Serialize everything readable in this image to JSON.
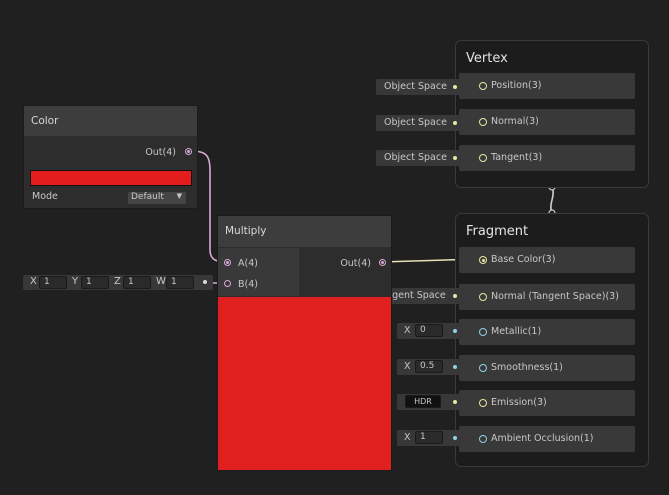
{
  "vertex": {
    "title": "Vertex",
    "slots": [
      {
        "label": "Position(3)",
        "input": "Object Space"
      },
      {
        "label": "Normal(3)",
        "input": "Object Space"
      },
      {
        "label": "Tangent(3)",
        "input": "Object Space"
      }
    ]
  },
  "fragment": {
    "title": "Fragment",
    "slots": [
      {
        "label": "Base Color(3)"
      },
      {
        "label": "Normal (Tangent Space)(3)",
        "input": "Tangent Space"
      },
      {
        "label": "Metallic(1)",
        "input_x_label": "X",
        "input_value": "0"
      },
      {
        "label": "Smoothness(1)",
        "input_x_label": "X",
        "input_value": "0.5"
      },
      {
        "label": "Emission(3)",
        "input": "HDR"
      },
      {
        "label": "Ambient Occlusion(1)",
        "input_x_label": "X",
        "input_value": "1"
      }
    ]
  },
  "color_node": {
    "title": "Color",
    "output": "Out(4)",
    "swatch_color": "#e31d1d",
    "mode_label": "Mode",
    "mode_value": "Default"
  },
  "multiply_node": {
    "title": "Multiply",
    "input_a": "A(4)",
    "input_b": "B(4)",
    "output": "Out(4)",
    "preview_color": "#e01f1f"
  },
  "vector4_input": {
    "x_label": "X",
    "x_value": "1",
    "y_label": "Y",
    "y_value": "1",
    "z_label": "Z",
    "z_value": "1",
    "w_label": "W",
    "w_value": "1"
  },
  "colors": {
    "background": "#202020",
    "vector3_port": "#e9e6a0",
    "float_port": "#8fd1e8",
    "vector4_port": "#d8a8d8"
  }
}
